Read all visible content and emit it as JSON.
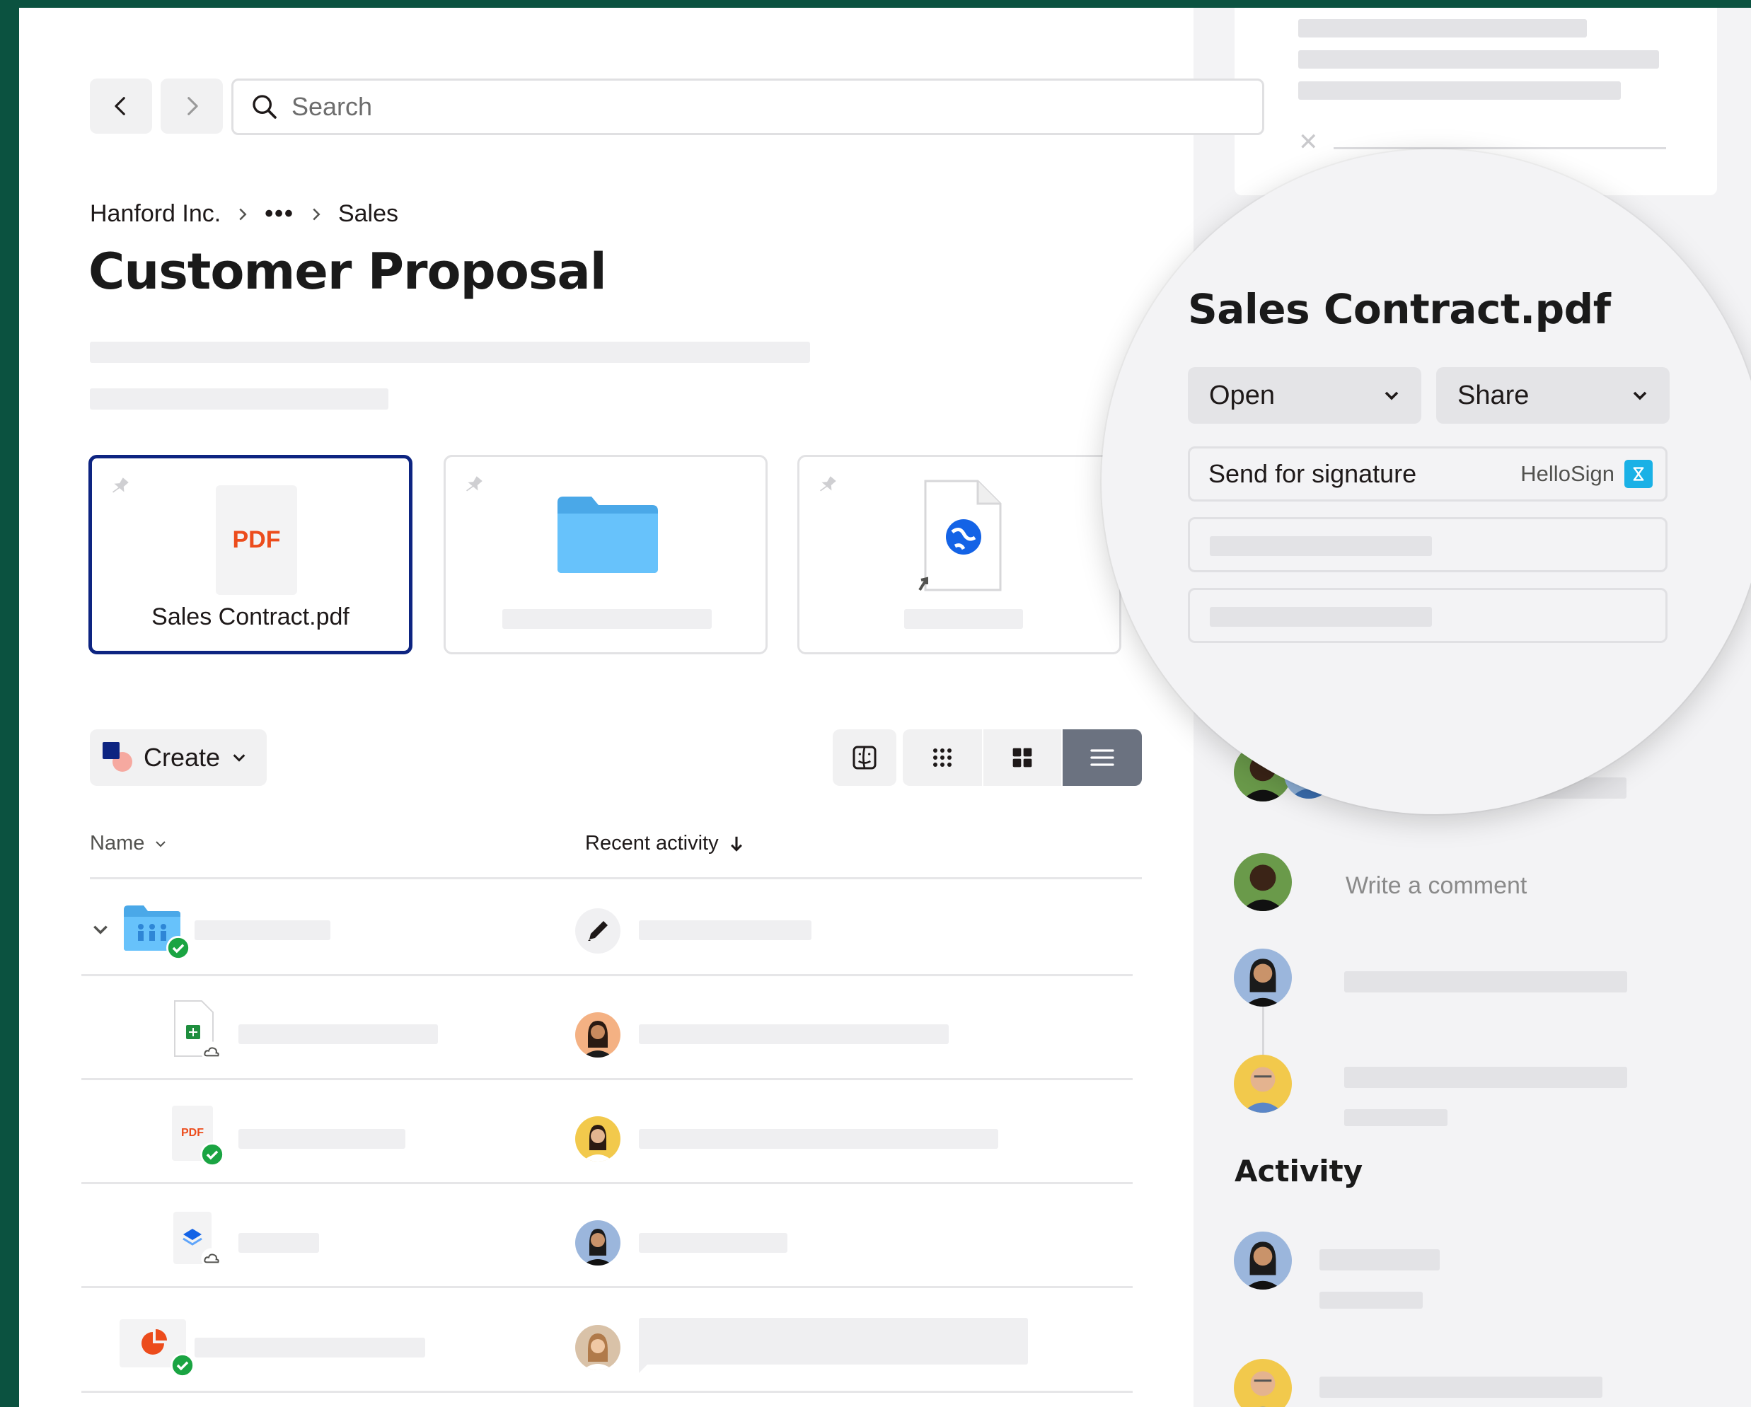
{
  "search": {
    "placeholder": "Search"
  },
  "breadcrumb": {
    "root": "Hanford Inc.",
    "ellipsis": "•••",
    "current": "Sales"
  },
  "page_title": "Customer Proposal",
  "pinned": {
    "selected_file": "Sales Contract.pdf",
    "pdf_badge": "PDF"
  },
  "toolbar": {
    "create_label": "Create"
  },
  "columns": {
    "name": "Name",
    "recent_activity": "Recent activity"
  },
  "row_icons": {
    "pdf_badge": "PDF"
  },
  "side": {
    "comment_placeholder": "Write a comment",
    "activity_title": "Activity"
  },
  "lens": {
    "file_name": "Sales Contract.pdf",
    "open_label": "Open",
    "share_label": "Share",
    "signature_label": "Send for signature",
    "signature_brand": "HelloSign"
  },
  "colors": {
    "accent_navy": "#0d2481",
    "pdf_orange": "#ec4c1c",
    "folder_blue": "#5ab8f5",
    "hellosign_blue": "#1ab1e6",
    "check_green": "#1aa442",
    "frame_green": "#0b5240"
  }
}
